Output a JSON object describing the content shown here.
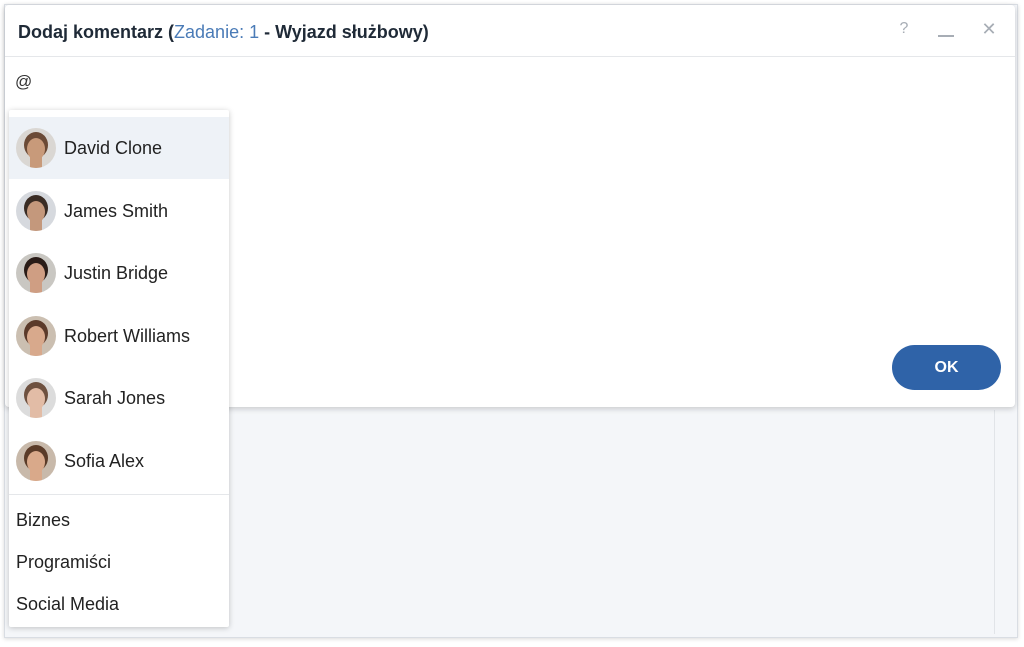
{
  "dialog": {
    "title_prefix": "Dodaj komentarz (",
    "task_label": "Zadanie: 1",
    "title_suffix_normal": " - ",
    "task_name": "Wyjazd służbowy",
    "title_close": ")",
    "help_glyph": "?",
    "close_glyph": "✕"
  },
  "editor": {
    "value": "@"
  },
  "ok_label": "OK",
  "mention": {
    "users": [
      {
        "name": "David Clone",
        "skin": "#c89a7a",
        "hair": "#6b4a36",
        "bg": "#dad7d3"
      },
      {
        "name": "James Smith",
        "skin": "#c4987c",
        "hair": "#3a2c24",
        "bg": "#d6d9de"
      },
      {
        "name": "Justin Bridge",
        "skin": "#cf9e83",
        "hair": "#2a1c17",
        "bg": "#c9c7c2"
      },
      {
        "name": "Robert Williams",
        "skin": "#d8a98c",
        "hair": "#5b3a2a",
        "bg": "#cbbfb1"
      },
      {
        "name": "Sarah Jones",
        "skin": "#e2bca6",
        "hair": "#6e5140",
        "bg": "#dcdcdc"
      },
      {
        "name": "Sofia Alex",
        "skin": "#d9a98a",
        "hair": "#5a3b28",
        "bg": "#c8b9aa"
      }
    ],
    "groups": [
      "Biznes",
      "Programiści",
      "Social Media"
    ]
  },
  "colors": {
    "accent": "#4a7bb7",
    "ok_button": "#2f63a8",
    "active_row": "#eef2f7"
  }
}
